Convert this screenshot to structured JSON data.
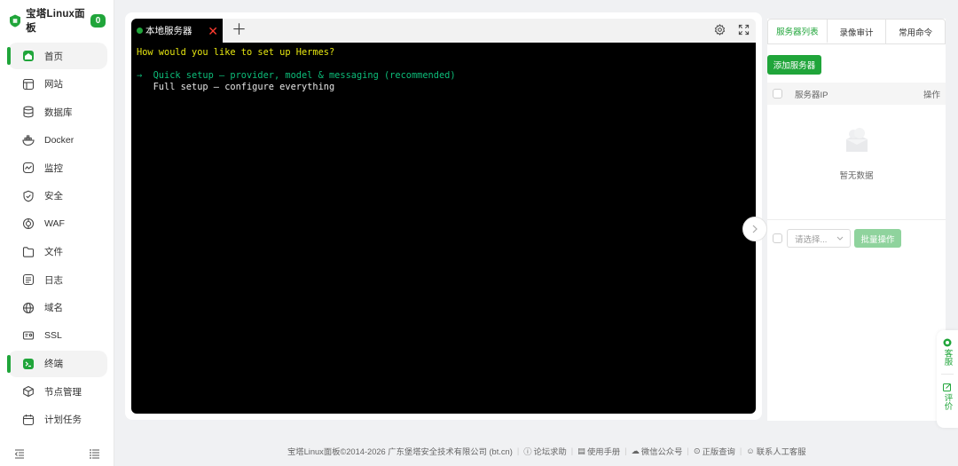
{
  "brand": {
    "title": "宝塔Linux面板",
    "badge": "0"
  },
  "nav": [
    {
      "label": "首页",
      "icon": "home-icon",
      "active": true
    },
    {
      "label": "网站",
      "icon": "website-icon",
      "active": false
    },
    {
      "label": "数据库",
      "icon": "database-icon",
      "active": false
    },
    {
      "label": "Docker",
      "icon": "docker-icon",
      "active": false
    },
    {
      "label": "监控",
      "icon": "monitor-icon",
      "active": false
    },
    {
      "label": "安全",
      "icon": "shield-icon",
      "active": false
    },
    {
      "label": "WAF",
      "icon": "waf-icon",
      "active": false
    },
    {
      "label": "文件",
      "icon": "folder-icon",
      "active": false
    },
    {
      "label": "日志",
      "icon": "log-icon",
      "active": false
    },
    {
      "label": "域名",
      "icon": "globe-icon",
      "active": false
    },
    {
      "label": "SSL",
      "icon": "ssl-icon",
      "active": false
    },
    {
      "label": "终端",
      "icon": "terminal-icon",
      "active": true
    },
    {
      "label": "节点管理",
      "icon": "node-icon",
      "active": false
    },
    {
      "label": "计划任务",
      "icon": "calendar-icon",
      "active": false
    }
  ],
  "terminal": {
    "tab_label": "本地服务器",
    "question": "How would you like to set up Hermes?",
    "option1": "→  Quick setup — provider, model & messaging (recommended)",
    "option2": "   Full setup — configure everything"
  },
  "panel": {
    "tabs": [
      "服务器列表",
      "录像审计",
      "常用命令"
    ],
    "add_button": "添加服务器",
    "col_ip": "服务器IP",
    "col_action": "操作",
    "empty_text": "暂无数据",
    "select_placeholder": "请选择...",
    "bulk_button": "批量操作"
  },
  "float": {
    "service": "客服",
    "rate": "评价"
  },
  "footer": {
    "copyright": "宝塔Linux面板©2014-2026 广东堡塔安全技术有限公司 (bt.cn)",
    "links": [
      "论坛求助",
      "使用手册",
      "微信公众号",
      "正版查询",
      "联系人工客服"
    ]
  },
  "colors": {
    "accent": "#20a53a",
    "terminal_bg": "#000000",
    "prompt_yellow": "#e5e510",
    "option_green": "#0dbc79"
  }
}
